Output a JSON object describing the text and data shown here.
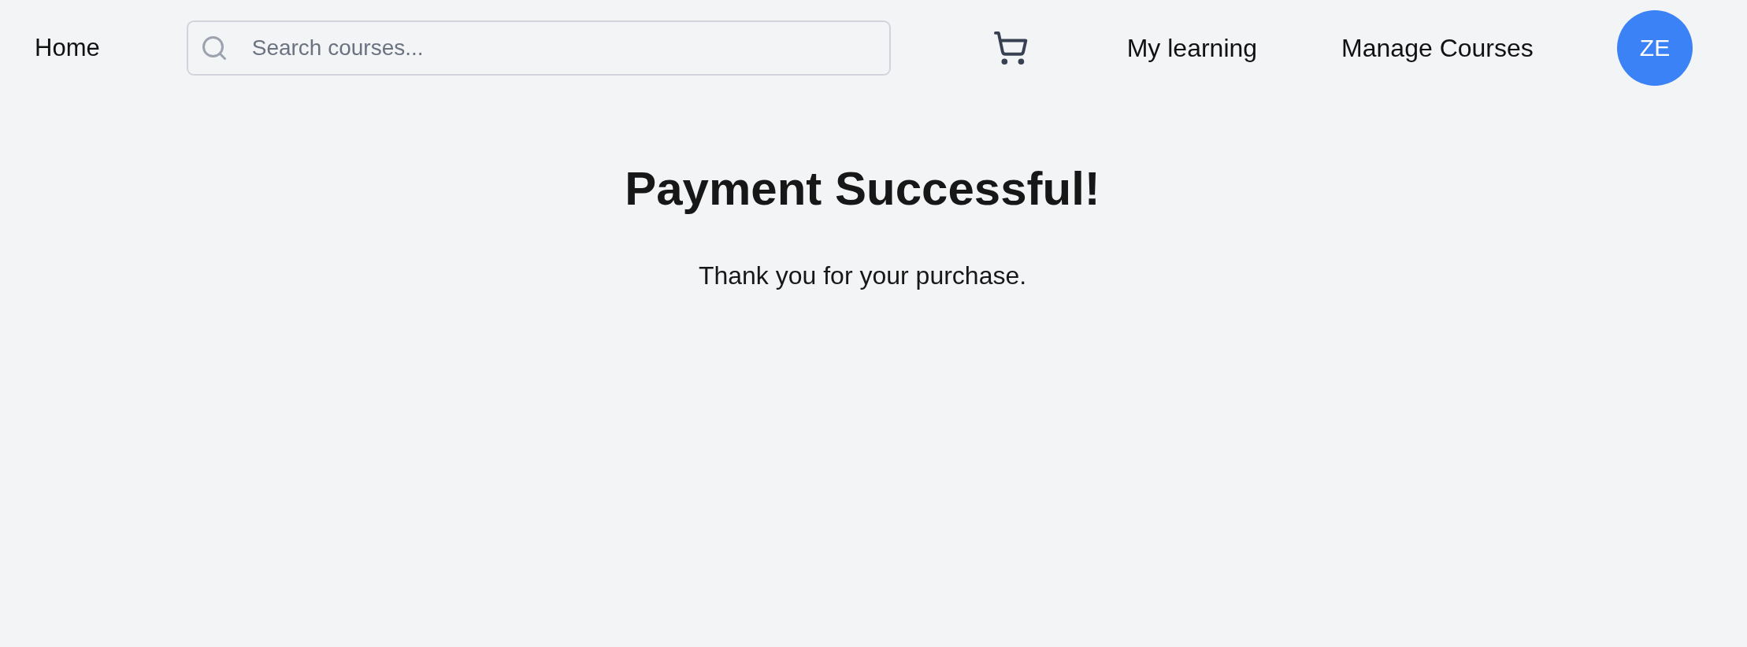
{
  "nav": {
    "home": "Home",
    "search": {
      "placeholder": "Search courses..."
    },
    "links": [
      "My learning",
      "Manage Courses"
    ],
    "avatar": {
      "initials": "ZE"
    }
  },
  "message": {
    "title": "Payment Successful!",
    "text": "Thank you for your purchase."
  }
}
